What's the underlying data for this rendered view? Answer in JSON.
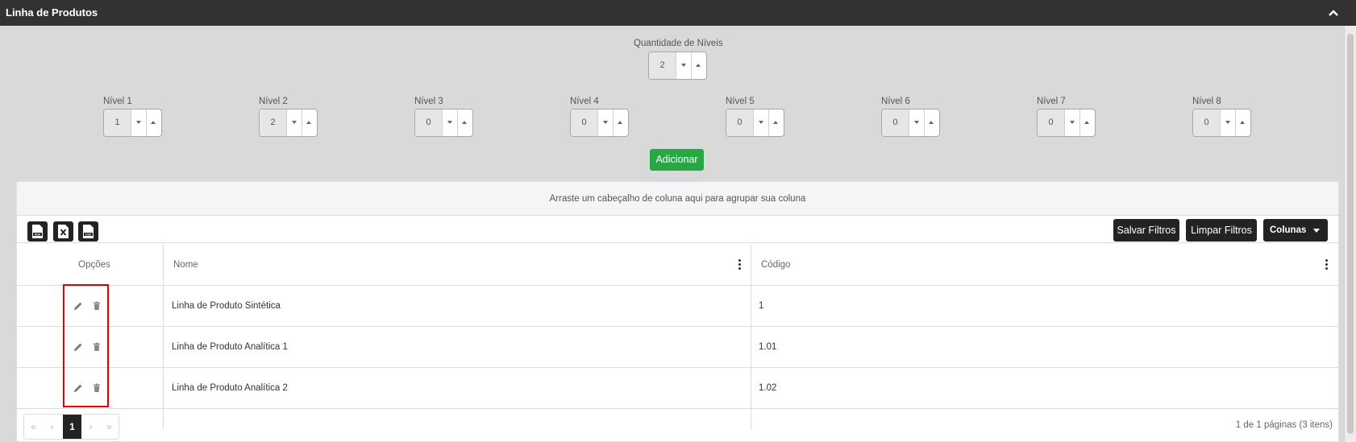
{
  "header": {
    "title": "Linha de Produtos",
    "collapse_icon": "chevron-up-icon"
  },
  "levels_count": {
    "label": "Quantidade de Níveis",
    "value": "2"
  },
  "levels": [
    {
      "label": "Nível 1",
      "value": "1"
    },
    {
      "label": "Nível 2",
      "value": "2"
    },
    {
      "label": "Nível 3",
      "value": "0"
    },
    {
      "label": "Nível 4",
      "value": "0"
    },
    {
      "label": "Nível 5",
      "value": "0"
    },
    {
      "label": "Nível 6",
      "value": "0"
    },
    {
      "label": "Nível 7",
      "value": "0"
    },
    {
      "label": "Nível 8",
      "value": "0"
    }
  ],
  "add_button": "Adicionar",
  "grid": {
    "group_hint": "Arraste um cabeçalho de coluna aqui para agrupar sua coluna",
    "exports": [
      "PDF",
      "XLS",
      "CSV"
    ],
    "buttons": {
      "save_filters": "Salvar Filtros",
      "clear_filters": "Limpar Filtros",
      "columns": "Colunas"
    },
    "columns": {
      "options": "Opções",
      "name": "Nome",
      "code": "Código"
    },
    "rows": [
      {
        "name": "Linha de Produto Sintética",
        "code": "1"
      },
      {
        "name": "Linha de Produto Analítica 1",
        "code": "1.01"
      },
      {
        "name": "Linha de Produto Analítica 2",
        "code": "1.02"
      }
    ],
    "pager": {
      "first": "«",
      "prev": "‹",
      "current": "1",
      "next": "›",
      "last": "»",
      "info": "1 de 1 páginas (3 itens)"
    }
  },
  "colors": {
    "header_bg": "#323232",
    "success": "#28a745",
    "dark_button": "#232323",
    "highlight": "#e00000"
  }
}
